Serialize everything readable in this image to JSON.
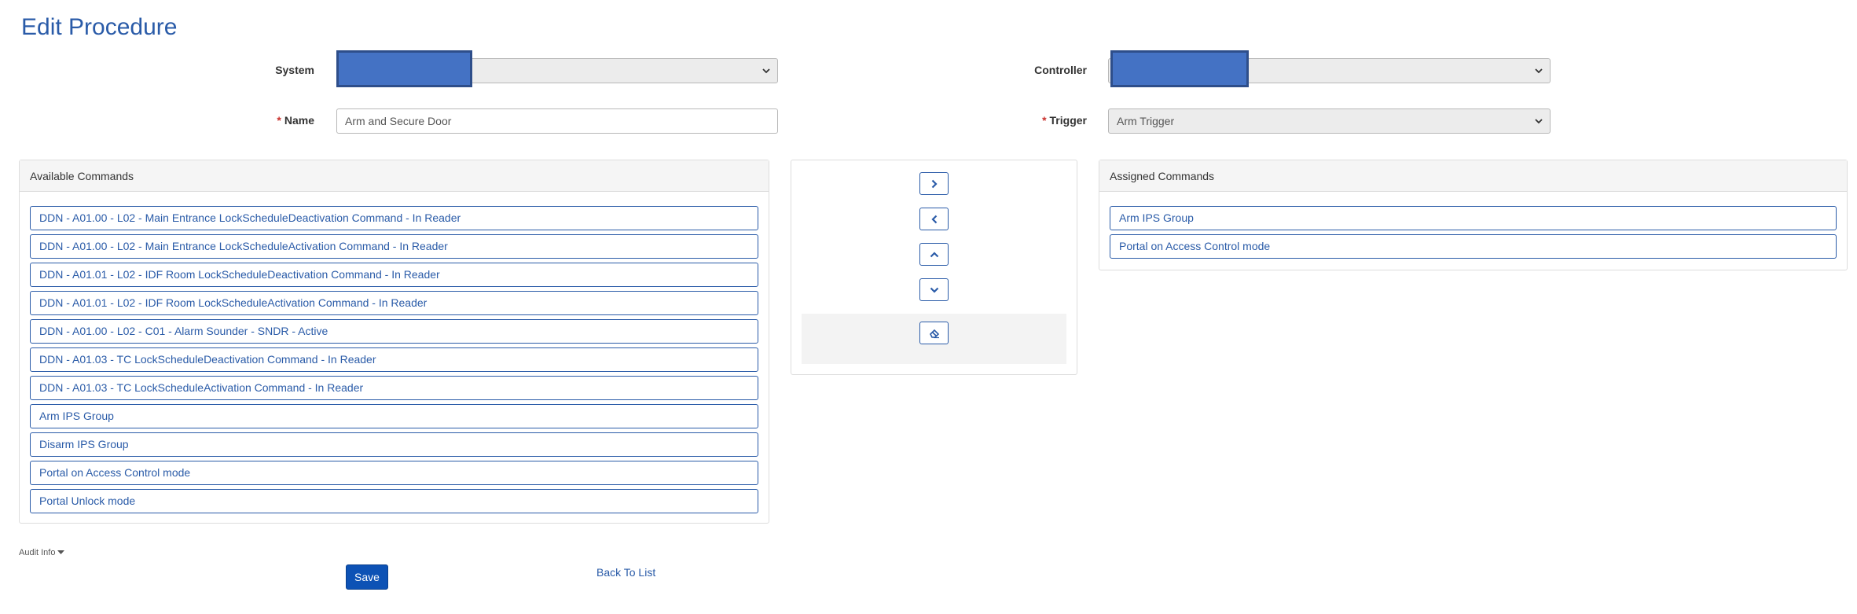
{
  "page": {
    "title": "Edit Procedure"
  },
  "form": {
    "system_label": "System",
    "system_value": "",
    "controller_label": "Controller",
    "controller_value": "",
    "name_required_mark": "*",
    "name_label": "Name",
    "name_value": "Arm and Secure Door",
    "trigger_required_mark": "*",
    "trigger_label": "Trigger",
    "trigger_value": "Arm Trigger"
  },
  "available": {
    "heading": "Available Commands",
    "items": [
      {
        "label": "DDN - A01.00 - L02 - Main Entrance LockScheduleDeactivation Command - In Reader"
      },
      {
        "label": "DDN - A01.00 - L02 - Main Entrance LockScheduleActivation Command - In Reader"
      },
      {
        "label": "DDN - A01.01 - L02 - IDF Room LockScheduleDeactivation Command - In Reader"
      },
      {
        "label": "DDN - A01.01 - L02 - IDF Room LockScheduleActivation Command - In Reader"
      },
      {
        "label": "DDN - A01.00 - L02 - C01 - Alarm Sounder - SNDR - Active"
      },
      {
        "label": "DDN - A01.03 - TC LockScheduleDeactivation Command - In Reader"
      },
      {
        "label": "DDN - A01.03 - TC LockScheduleActivation Command - In Reader"
      },
      {
        "label": "Arm IPS Group"
      },
      {
        "label": "Disarm IPS Group"
      },
      {
        "label": "Portal on Access Control mode"
      },
      {
        "label": "Portal Unlock mode"
      }
    ]
  },
  "assigned": {
    "heading": "Assigned Commands",
    "items": [
      {
        "label": "Arm IPS Group"
      },
      {
        "label": "Portal on Access Control mode"
      }
    ]
  },
  "controls": {
    "move_right_icon": "chevron-right-icon",
    "move_left_icon": "chevron-left-icon",
    "move_up_icon": "chevron-up-icon",
    "move_down_icon": "chevron-down-icon",
    "clear_icon": "eraser-icon"
  },
  "footer": {
    "audit_label": "Audit Info",
    "save_label": "Save",
    "back_label": "Back To List"
  },
  "colors": {
    "accent": "#2a5ba8",
    "primary_button": "#0d52b5",
    "redaction": "#4472c4",
    "required": "#c9302c"
  }
}
